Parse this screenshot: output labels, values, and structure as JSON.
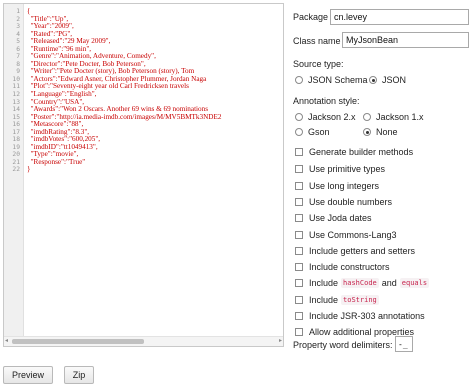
{
  "editor": {
    "json_lines": [
      "{",
      "  \"Title\":\"Up\",",
      "  \"Year\":\"2009\",",
      "  \"Rated\":\"PG\",",
      "  \"Released\":\"29 May 2009\",",
      "  \"Runtime\":\"96 min\",",
      "  \"Genre\":\"Animation, Adventure, Comedy\",",
      "  \"Director\":\"Pete Docter, Bob Peterson\",",
      "  \"Writer\":\"Pete Docter (story), Bob Peterson (story), Tom",
      "  \"Actors\":\"Edward Asner, Christopher Plummer, Jordan Naga",
      "  \"Plot\":\"Seventy-eight year old Carl Fredricksen travels",
      "  \"Language\":\"English\",",
      "  \"Country\":\"USA\",",
      "  \"Awards\":\"Won 2 Oscars. Another 69 wins & 69 nominations",
      "  \"Poster\":\"http://ia.media-imdb.com/images/M/MV5BMTk3NDE2",
      "  \"Metascore\":\"88\",",
      "  \"imdbRating\":\"8.3\",",
      "  \"imdbVotes\":\"600,205\",",
      "  \"imdbID\":\"tt1049413\",",
      "  \"Type\":\"movie\",",
      "  \"Response\":\"True\"",
      "}"
    ],
    "line_numbers": [
      "1",
      "2",
      "3",
      "4",
      "5",
      "6",
      "7",
      "8",
      "9",
      "10",
      "11",
      "12",
      "13",
      "14",
      "15",
      "16",
      "17",
      "18",
      "19",
      "20",
      "21",
      "22"
    ]
  },
  "form": {
    "package_label": "Package",
    "package_value": "cn.levey",
    "class_name_label": "Class name",
    "class_name_value": "MyJsonBean",
    "source_type_label": "Source type:",
    "source_types": [
      {
        "label": "JSON Schema",
        "selected": false
      },
      {
        "label": "JSON",
        "selected": true
      }
    ],
    "annotation_style_label": "Annotation style:",
    "annotation_styles": [
      {
        "label": "Jackson 2.x",
        "selected": false
      },
      {
        "label": "Jackson 1.x",
        "selected": false
      },
      {
        "label": "Gson",
        "selected": false
      },
      {
        "label": "None",
        "selected": true
      }
    ],
    "options": [
      {
        "label": "Generate builder methods",
        "checked": false
      },
      {
        "label": "Use primitive types",
        "checked": false
      },
      {
        "label": "Use long integers",
        "checked": false
      },
      {
        "label": "Use double numbers",
        "checked": false
      },
      {
        "label": "Use Joda dates",
        "checked": false
      },
      {
        "label": "Use Commons-Lang3",
        "checked": false
      },
      {
        "label": "Include getters and setters",
        "checked": false
      },
      {
        "label": "Include constructors",
        "checked": false
      }
    ],
    "include_hashcode": {
      "prefix": "Include",
      "code1": "hashCode",
      "and": "and",
      "code2": "equals"
    },
    "include_tostring": {
      "prefix": "Include",
      "code": "toString"
    },
    "options2": [
      {
        "label": "Include JSR-303 annotations",
        "checked": false
      },
      {
        "label": "Allow additional properties",
        "checked": false
      }
    ],
    "delimiters_label": "Property word delimiters:",
    "delimiters_value": "-_"
  },
  "buttons": {
    "preview": "Preview",
    "zip": "Zip"
  },
  "colors": {
    "json_string": "#c80000",
    "code_tag_text": "#c7254e"
  }
}
